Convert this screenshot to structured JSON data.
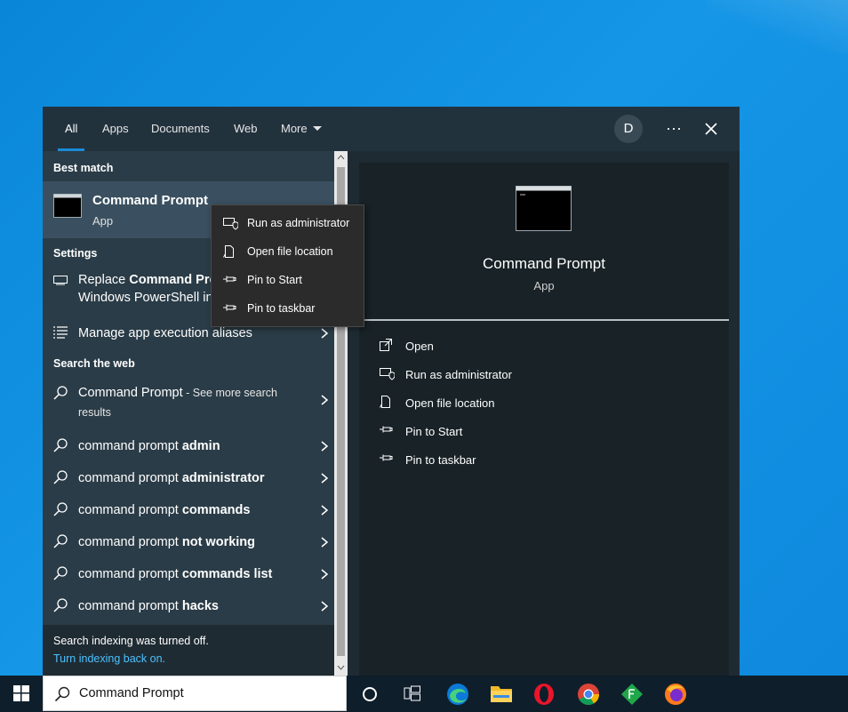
{
  "tabs": [
    "All",
    "Apps",
    "Documents",
    "Web",
    "More"
  ],
  "user_initial": "D",
  "more_options": "···",
  "best_match": {
    "header": "Best match",
    "title": "Command Prompt",
    "subtitle": "App"
  },
  "settings": {
    "header": "Settings",
    "item1_line1_prefix": "Replace ",
    "item1_line1_bold": "Command Pro",
    "item1_line2": "Windows PowerShell in",
    "item2": "Manage app execution aliases"
  },
  "web": {
    "header": "Search the web",
    "first_main": "Command Prompt",
    "first_suffix": " - See more search",
    "first_suffix2": "results",
    "items": [
      {
        "prefix": "command prompt ",
        "bold": "admin"
      },
      {
        "prefix": "command prompt ",
        "bold": "administrator"
      },
      {
        "prefix": "command prompt ",
        "bold": "commands"
      },
      {
        "prefix": "command prompt ",
        "bold": "not working"
      },
      {
        "prefix": "command prompt ",
        "bold": "commands list"
      },
      {
        "prefix": "command prompt ",
        "bold": "hacks"
      }
    ]
  },
  "indexing": {
    "message": "Search indexing was turned off.",
    "link": "Turn indexing back on."
  },
  "preview": {
    "title": "Command Prompt",
    "subtitle": "App",
    "actions": [
      "Open",
      "Run as administrator",
      "Open file location",
      "Pin to Start",
      "Pin to taskbar"
    ]
  },
  "context_menu": [
    "Run as administrator",
    "Open file location",
    "Pin to Start",
    "Pin to taskbar"
  ],
  "search_box": {
    "value": "Command Prompt"
  },
  "taskbar_icons": [
    "windows-start-icon",
    "cortana-icon",
    "task-view-icon",
    "edge-icon",
    "file-explorer-icon",
    "opera-icon",
    "chrome-icon",
    "green-app-icon",
    "firefox-icon"
  ],
  "colors": {
    "accent": "#1a8ad6",
    "link": "#4cc2ff",
    "panel": "#1f2b33"
  }
}
